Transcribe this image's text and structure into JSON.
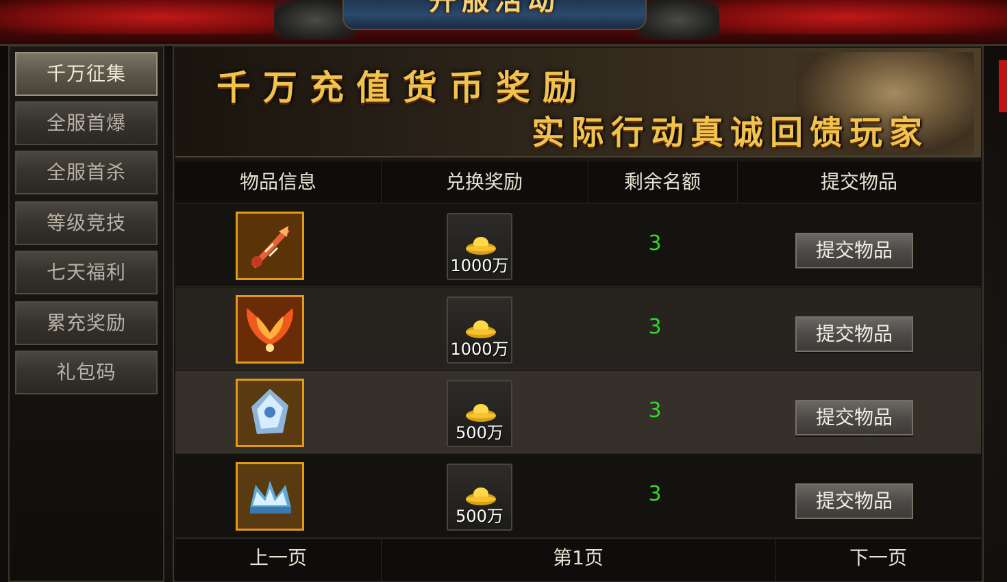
{
  "header": {
    "title": "开服活动"
  },
  "sidebar": {
    "items": [
      {
        "label": "千万征集",
        "active": true
      },
      {
        "label": "全服首爆",
        "active": false
      },
      {
        "label": "全服首杀",
        "active": false
      },
      {
        "label": "等级竞技",
        "active": false
      },
      {
        "label": "七天福利",
        "active": false
      },
      {
        "label": "累充奖励",
        "active": false
      },
      {
        "label": "礼包码",
        "active": false
      }
    ]
  },
  "banner": {
    "line1": "千万充值货币奖励",
    "line2": "实际行动真诚回馈玩家"
  },
  "table": {
    "headers": [
      "物品信息",
      "兑换奖励",
      "剩余名额",
      "提交物品"
    ],
    "rows": [
      {
        "item_icon": "sword-icon",
        "reward_icon": "gold-ingot-icon",
        "reward": "1000万",
        "remaining": "3",
        "button": "提交物品"
      },
      {
        "item_icon": "phoenix-wings-icon",
        "reward_icon": "gold-ingot-icon",
        "reward": "1000万",
        "remaining": "3",
        "button": "提交物品"
      },
      {
        "item_icon": "crystal-icon",
        "reward_icon": "gold-ingot-icon",
        "reward": "500万",
        "remaining": "3",
        "button": "提交物品"
      },
      {
        "item_icon": "crown-icon",
        "reward_icon": "gold-ingot-icon",
        "reward": "500万",
        "remaining": "3",
        "button": "提交物品"
      }
    ]
  },
  "pager": {
    "prev": "上一页",
    "current": "第1页",
    "next": "下一页"
  },
  "colors": {
    "remaining_green": "#35d62e",
    "icon_border_gold": "#e39b16",
    "banner_gold": "#f0c24e"
  }
}
